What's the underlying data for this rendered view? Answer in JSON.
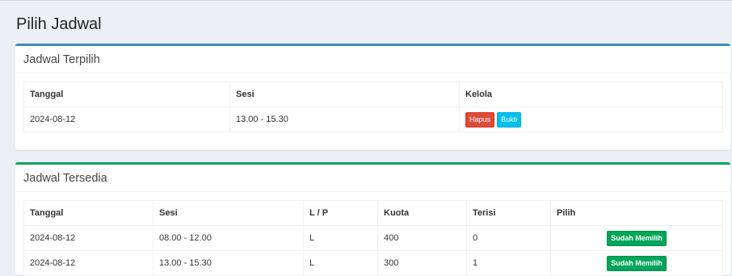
{
  "page": {
    "title": "Pilih Jadwal"
  },
  "selected": {
    "title": "Jadwal Terpilih",
    "headers": [
      "Tanggal",
      "Sesi",
      "Kelola"
    ],
    "rows": [
      {
        "tanggal": "2024-08-12",
        "sesi": "13.00 - 15.30",
        "delete_label": "Hapus",
        "proof_label": "Bukti"
      }
    ]
  },
  "available": {
    "title": "Jadwal Tersedia",
    "headers": [
      "Tanggal",
      "Sesi",
      "L / P",
      "Kuota",
      "Terisi",
      "Pilih"
    ],
    "rows": [
      {
        "tanggal": "2024-08-12",
        "sesi": "08.00 - 12.00",
        "lp": "L",
        "kuota": "400",
        "terisi": "0",
        "status": "Sudah Memilih"
      },
      {
        "tanggal": "2024-08-12",
        "sesi": "13.00 - 15.30",
        "lp": "L",
        "kuota": "300",
        "terisi": "1",
        "status": "Sudah Memilih"
      }
    ]
  },
  "colors": {
    "primary": "#3c8dbc",
    "success": "#00a65a",
    "danger": "#dd4b39",
    "info": "#00c0ef"
  }
}
